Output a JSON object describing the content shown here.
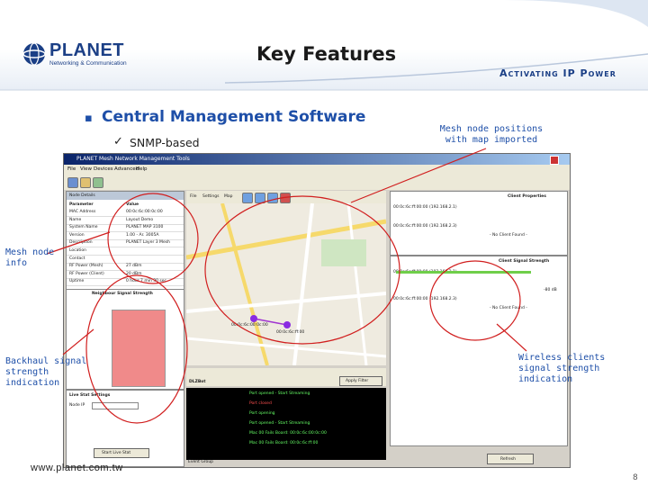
{
  "brand": {
    "logo_text": "PLANET",
    "logo_tagline": "Networking & Communication",
    "tagline": "Activating IP Power",
    "url": "www.planet.com.tw"
  },
  "slide": {
    "title": "Key Features",
    "bullet1": "Central Management Software",
    "bullet2": "SNMP-based",
    "page_number": "8"
  },
  "callouts": {
    "mesh_positions": [
      "Mesh node positions",
      "with map imported"
    ],
    "node_info": [
      "Mesh node",
      "info"
    ],
    "backhaul": [
      "Backhaul signal",
      "strength",
      "indication"
    ],
    "wireless": [
      "Wireless clients",
      "signal strength",
      "indication"
    ]
  },
  "app": {
    "title": "PLANET Mesh Network Management Tools",
    "menu": [
      "File",
      "View",
      "Devices",
      "Advanced",
      "Help"
    ],
    "node_panel_title": "Node Details",
    "node_columns": [
      "Parameter",
      "Value"
    ],
    "node_rows": [
      [
        "MAC Address",
        "00:0c:6c:00:0c:00"
      ],
      [
        "Name",
        "Layout Demo"
      ],
      [
        "System Name",
        "PLANET MAP 3100"
      ],
      [
        "Version",
        "1.00 - Ar. 3005A"
      ],
      [
        "Description",
        "PLANET Layer 3 Mesh"
      ],
      [
        "Location",
        ""
      ],
      [
        "Contact",
        ""
      ],
      [
        "RF Power (Mesh)",
        "27 dBm"
      ],
      [
        "RF Power (Client)",
        "20 dBm"
      ],
      [
        "Uptime",
        "0 hour 7 min 30 sec"
      ]
    ],
    "neighbor_title": "Neighbour Signal Strength",
    "map_menu": [
      "File",
      "Settings",
      "Map"
    ],
    "map_tab": "DLZBot",
    "map_nodes": [
      "00:0c:6c:00:0c:00",
      "00:0c:6c:ff:00"
    ],
    "client_props": "Client Properties",
    "client_entries": [
      "00:0c:6c:ff:00:00 (192.168.2.1)",
      "00:0c:6c:ff:00:00 (192.168.2.3)"
    ],
    "no_client": "- No Client Found -",
    "signal_title": "Client Signal Strength",
    "signal_value": "-80 dB",
    "live_stat": "Live Stat Settings",
    "node_ip_label": "Node IP",
    "start_button": "Start Live Stat",
    "refresh_button": "Refresh",
    "apply_button": "Apply Filter",
    "log_label": "DLZBot",
    "log_lines": [
      "Port opened - Start Streaming",
      "Port closed",
      "Port opening",
      "Port opened - Start Streaming",
      "Mac 00 Fails Board: 00:0c:6c:00:0c:00",
      "Mac 00 Fails Board: 00:0c:6c:ff:00"
    ],
    "status_bar": "Event Group"
  },
  "colors": {
    "accent_blue": "#1e4fa8",
    "callout_red": "#d11f1f",
    "brand_navy": "#1b3f86"
  }
}
